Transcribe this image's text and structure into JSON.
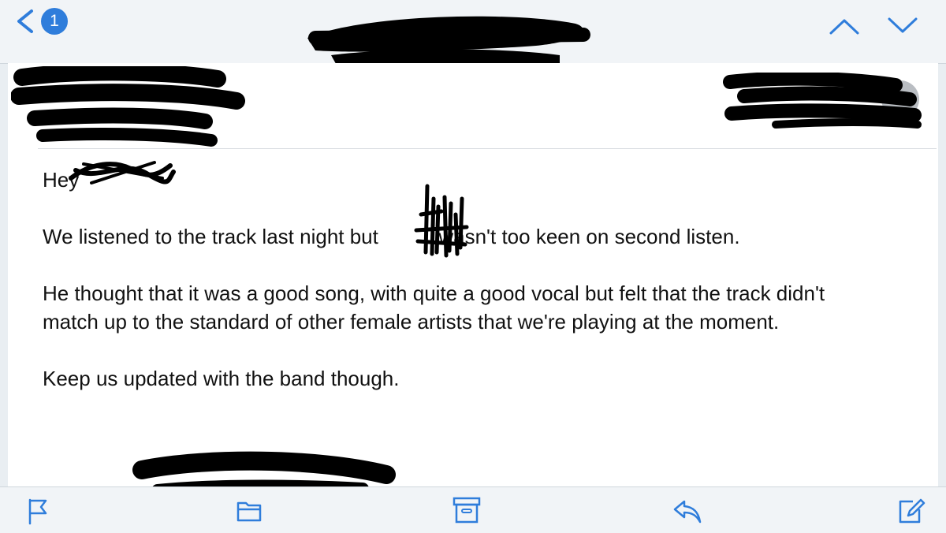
{
  "header": {
    "unread_count": "1",
    "icons": [
      "back-chevron-icon",
      "chevron-up-icon",
      "chevron-down-icon"
    ]
  },
  "message": {
    "greeting": "Hey",
    "paragraphs": [
      {
        "before": "We listened to the track last night but",
        "after": "wasn't too keen on second listen."
      },
      {
        "text": "He thought that it was a good song, with quite a good vocal but felt that the track didn't match up to the standard of other female artists that we're playing at the moment."
      },
      {
        "text": "Keep us updated with the band though."
      }
    ]
  },
  "toolbar": {
    "icons": [
      "flag-icon",
      "folder-icon",
      "archive-icon",
      "reply-icon",
      "compose-icon"
    ]
  },
  "colors": {
    "accent": "#2f7ddb",
    "toolbar_bg": "#f1f4f7",
    "text": "#111111",
    "redaction": "#000000"
  }
}
